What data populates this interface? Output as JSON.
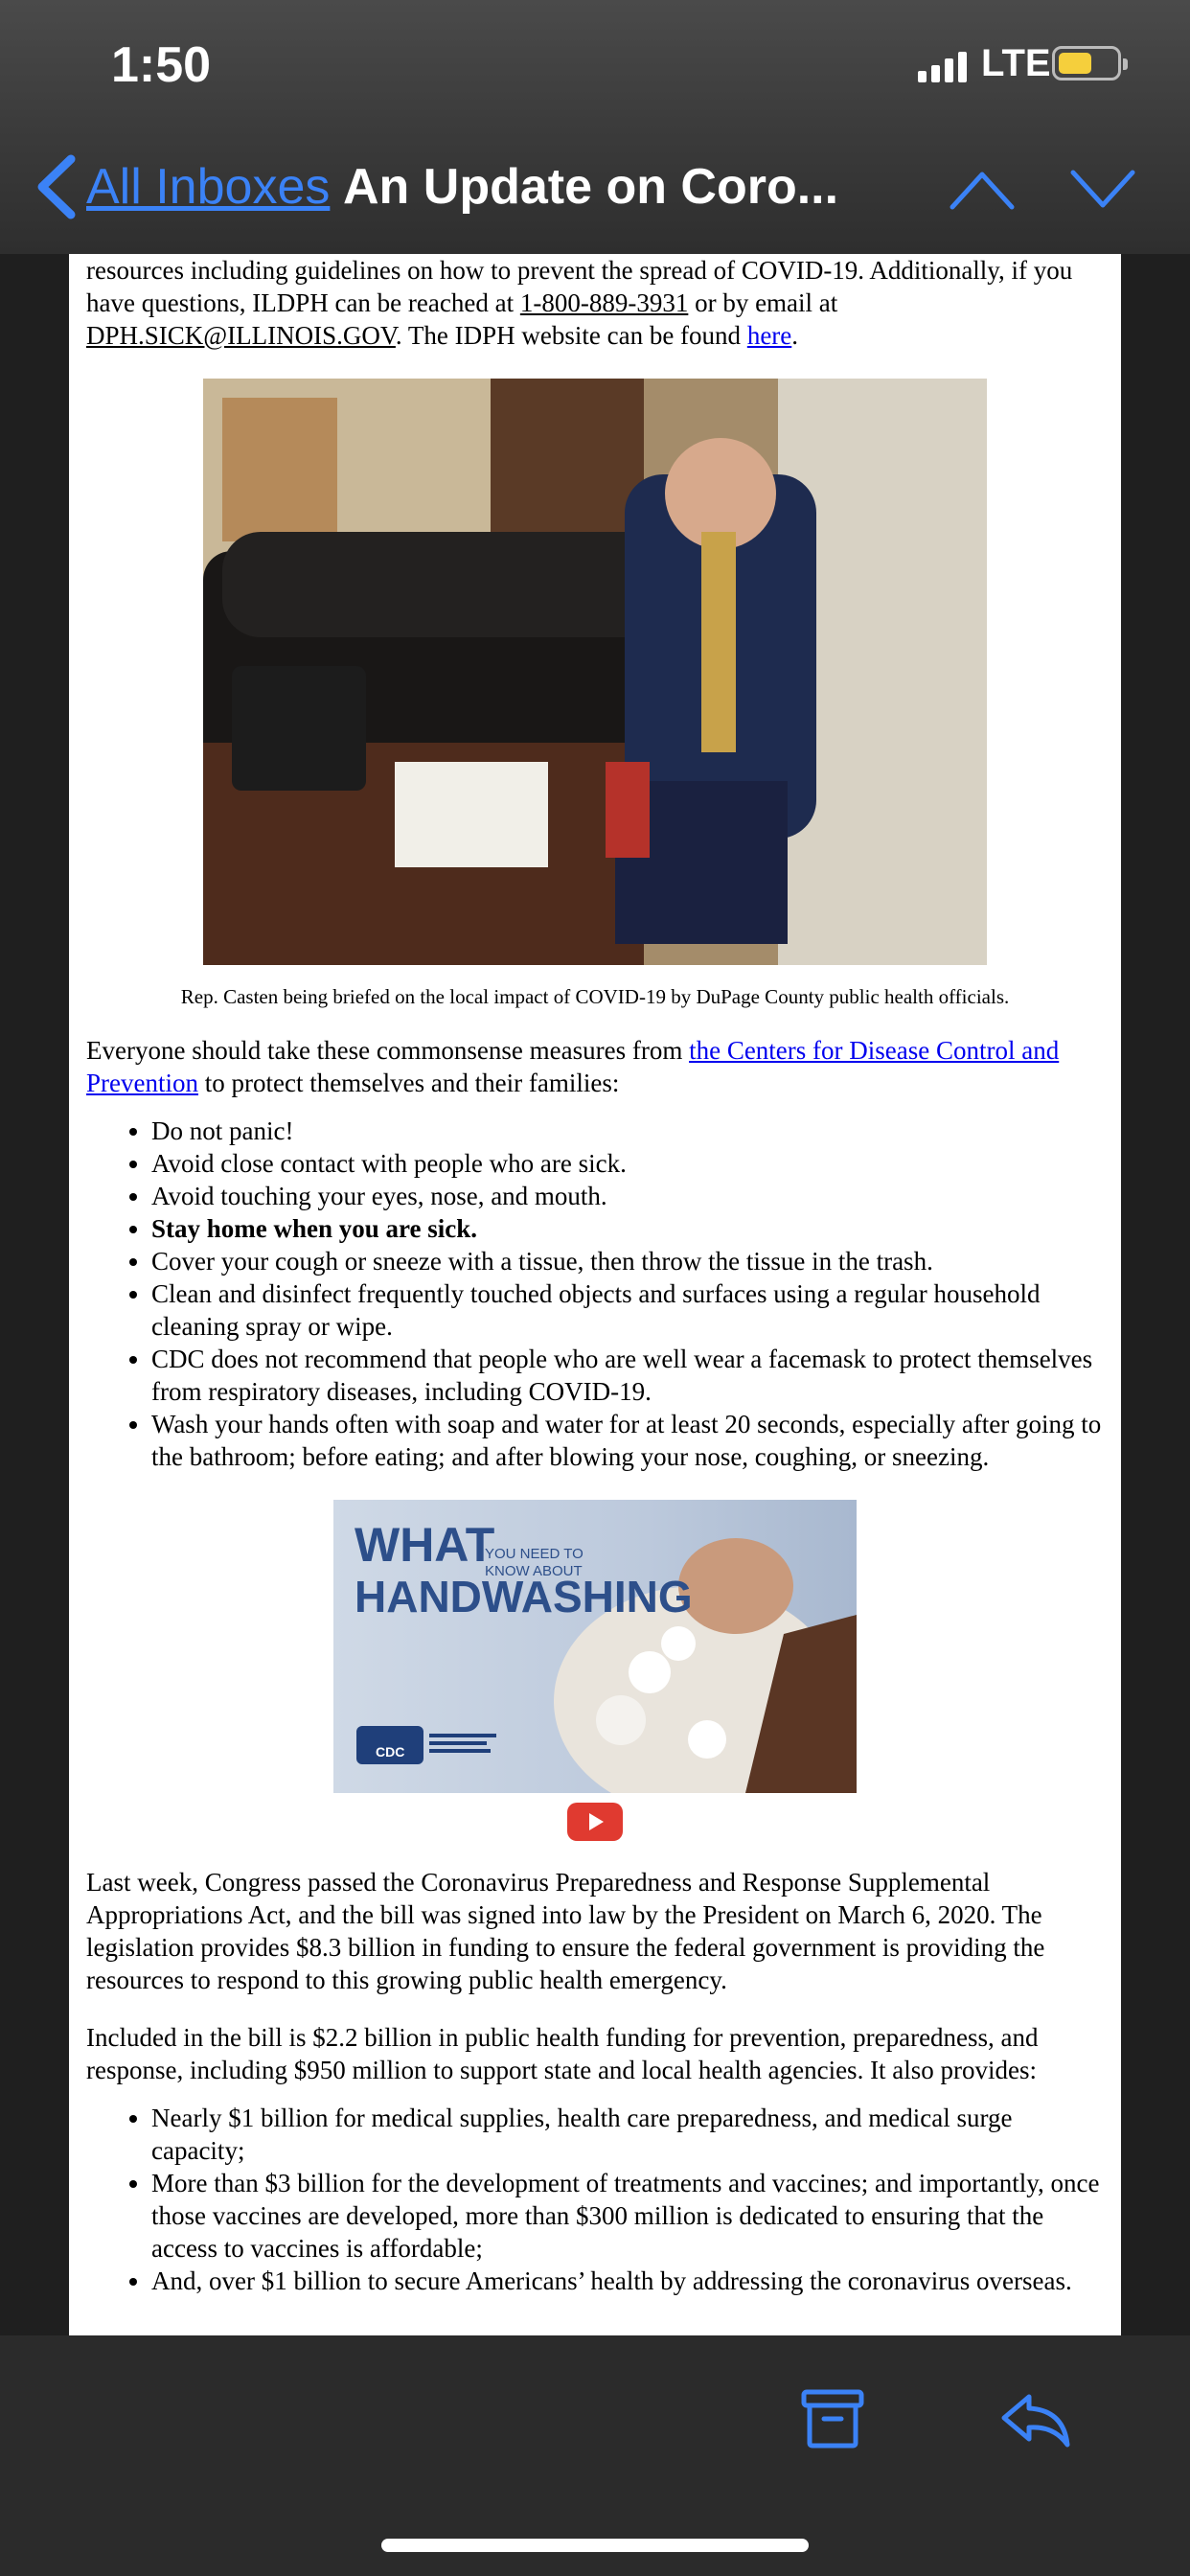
{
  "status": {
    "time": "1:50",
    "network": "LTE"
  },
  "nav": {
    "back_label": "All Inboxes",
    "title": "An Update on Coro..."
  },
  "email": {
    "intro_cut": "resources including guidelines on how to prevent the spread of COVID-19. Additionally, if you have questions, ILDPH can be reached at",
    "phone": "1-800-889-3931",
    "email_or": "or by email at",
    "email_address": "DPH.SICK@ILLINOIS.GOV",
    "website_text": ". The IDPH website can be found",
    "website_link": "here",
    "caption": "Rep. Casten being briefed on the local impact of COVID-19 by DuPage County public health officials.",
    "measures_intro_pre": "Everyone should take these commonsense measures from",
    "measures_link": "the Centers for Disease Control and Prevention",
    "measures_intro_post": "to protect themselves and their families:",
    "measures": [
      "Do not panic!",
      "Avoid close contact with people who are sick.",
      "Avoid touching your eyes, nose, and mouth.",
      "Stay home when you are sick.",
      "Cover your cough or sneeze with a tissue, then throw the tissue in the trash.",
      "Clean and disinfect frequently touched objects and surfaces using a regular household cleaning spray or wipe.",
      "CDC does not recommend that people who are well wear a facemask to protect themselves from respiratory diseases, including COVID-19.",
      "Wash your hands often with soap and water for at least 20 seconds, especially after going to the bathroom; before eating; and after blowing your nose, coughing, or sneezing."
    ],
    "video": {
      "what": "WHAT",
      "you_need_1": "YOU NEED TO",
      "you_need_2": "KNOW ABOUT",
      "handwashing": "HANDWASHING",
      "cdc": "CDC"
    },
    "congress_para": "Last week, Congress passed the Coronavirus Preparedness and Response Supplemental Appropriations Act, and the bill was signed into law by the President on March 6, 2020. The legislation provides $8.3 billion in funding to ensure the federal government is providing the resources to respond to this growing public health emergency.",
    "bill_para": "Included in the bill is $2.2 billion in public health funding for prevention, preparedness, and response, including $950 million to support state and local health agencies. It also provides:",
    "bill_items": [
      "Nearly $1 billion for medical supplies, health care preparedness, and medical surge capacity;",
      "More than $3 billion for the development of treatments and vaccines; and importantly, once those vaccines are developed, more than $300 million is dedicated to ensuring that the access to vaccines is affordable;",
      "And, over $1 billion to secure Americans’ health by addressing the coronavirus overseas."
    ]
  },
  "colors": {
    "accent": "#3b82f6",
    "link": "#0000ee",
    "battery": "#f5cf3c"
  }
}
